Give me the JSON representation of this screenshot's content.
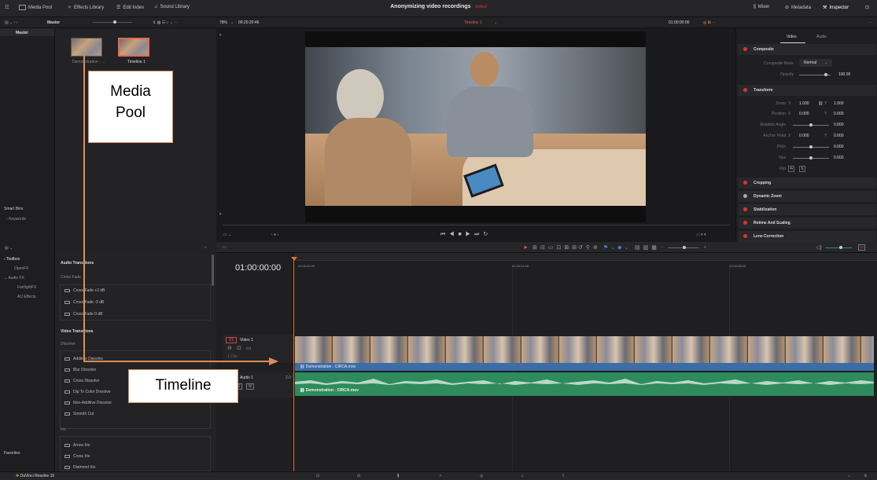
{
  "topbar": {
    "media_pool": "Media Pool",
    "effects_library": "Effects Library",
    "edit_index": "Edit Index",
    "sound_library": "Sound Library",
    "project_title": "Anonymizing video recordings",
    "edited": "Edited",
    "mixer": "Mixer",
    "metadata": "Metadata",
    "inspector": "Inspector"
  },
  "bar2": {
    "bin_label": "Master",
    "zoom": "78%",
    "timecode_left": "00:20:20:46",
    "timeline_name": "Timeline 1",
    "timecode_right": "01:00:00:00"
  },
  "media_pool": {
    "bin_title": "Master",
    "clips": [
      {
        "name": "Demonstration - ..."
      },
      {
        "name": "Timeline 1"
      }
    ],
    "smart_bins": "Smart Bins",
    "keywords": "Keywords",
    "favorites": "Favorites"
  },
  "inspector": {
    "tab_video": "Video",
    "tab_audio": "Audio",
    "composite": "Composite",
    "composite_mode_label": "Composite Mode",
    "composite_mode_value": "Normal",
    "opacity_label": "Opacity",
    "opacity_value": "100.00",
    "transform": "Transform",
    "zoom_label": "Zoom",
    "zoom_x": "1.000",
    "zoom_y": "1.000",
    "position_label": "Position",
    "pos_x": "0.000",
    "pos_y": "0.000",
    "rotation_label": "Rotation Angle",
    "rotation_value": "0.000",
    "anchor_label": "Anchor Point",
    "anchor_x": "0.000",
    "anchor_y": "0.000",
    "pitch_label": "Pitch",
    "pitch_value": "0.000",
    "yaw_label": "Yaw",
    "yaw_value": "0.000",
    "flip_label": "Flip",
    "x": "X",
    "y": "Y",
    "cropping": "Cropping",
    "dynamic_zoom": "Dynamic Zoom",
    "stabilization": "Stabilization",
    "retime": "Retime And Scaling",
    "lens": "Lens Correction"
  },
  "toolbox": {
    "nav": [
      "Toolbox",
      "OpenFX",
      "Audio FX",
      "FairlightFX",
      "AU Effects"
    ],
    "audio_transitions": "Audio Transitions",
    "cross_fade": "Cross Fade",
    "audio_items": [
      "Cross Fade +3 dB",
      "Cross Fade -3 dB",
      "Cross Fade 0 dB"
    ],
    "video_transitions": "Video Transitions",
    "dissolve": "Dissolve",
    "video_items": [
      "Additive Dissolve",
      "Blur Dissolve",
      "Cross Dissolve",
      "Dip To Color Dissolve",
      "Non-Additive Dissolve",
      "Smooth Cut"
    ],
    "iris": "Iris",
    "iris_items": [
      "Arrow Iris",
      "Cross Iris",
      "Diamond Iris"
    ]
  },
  "timeline": {
    "timecode": "01:00:00:00",
    "ruler": [
      "01:00:00:00",
      "01:00:04:00",
      "01:00:08:00"
    ],
    "v1_tag": "V1",
    "v1_name": "Video 1",
    "v1_clip_count": "1 Clip",
    "a1_tag": "A1",
    "a1_name": "Audio 1",
    "a1_channels": "2.0",
    "clip_name": "Demonstration - CIRCA.mov",
    "audio_clip_name": "Demonstration - CIRCA.mov"
  },
  "bottombar": {
    "app_name": "DaVinci Resolve 16"
  },
  "annotations": {
    "media_pool_line1": "Media",
    "media_pool_line2": "Pool",
    "timeline": "Timeline",
    "accent_color": "#e08b55"
  }
}
